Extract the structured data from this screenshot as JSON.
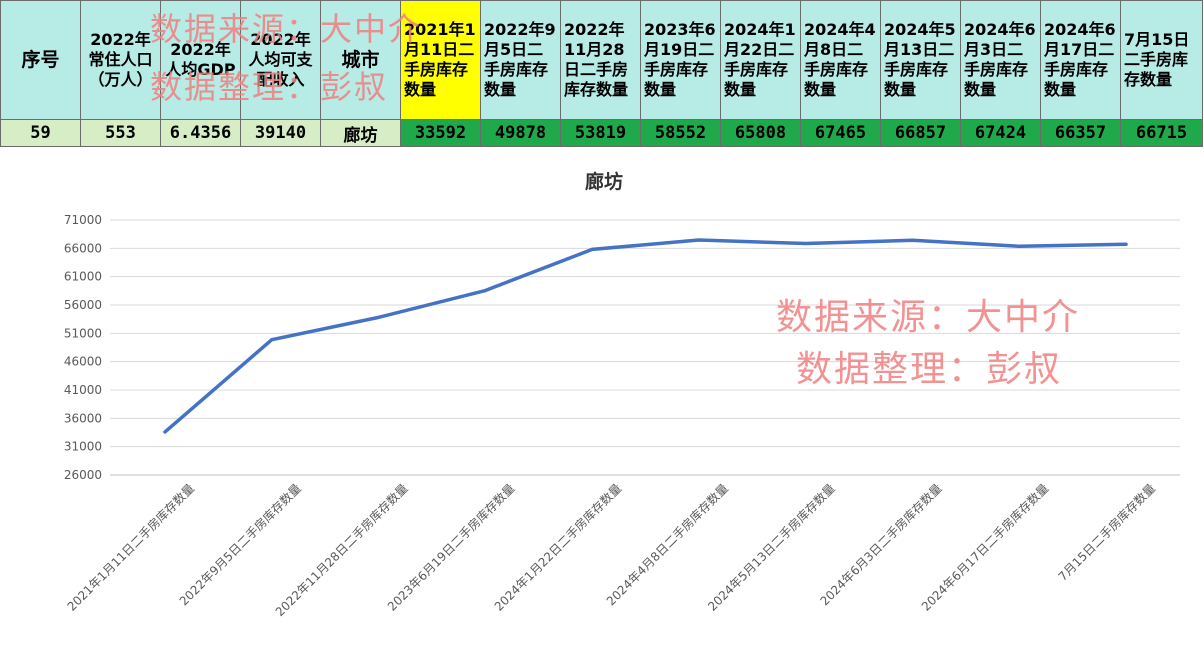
{
  "table": {
    "headers": [
      "序号",
      "2022年常住人口（万人）",
      "2022年人均GDP",
      "2022年人均可支配收入",
      "城市",
      "2021年1月11日二手房库存数量",
      "2022年9月5日二手房库存数量",
      "2022年11月28日二手房库存数量",
      "2023年6月19日二手房库存数量",
      "2024年1月22日二手房库存数量",
      "2024年4月8日二手房库存数量",
      "2024年5月13日二手房库存数量",
      "2024年6月3日二手房库存数量",
      "2024年6月17日二手房库存数量",
      "7月15日二手房库存数量"
    ],
    "row": [
      "59",
      "553",
      "6.4356",
      "39140",
      "廊坊",
      "33592",
      "49878",
      "53819",
      "58552",
      "65808",
      "67465",
      "66857",
      "67424",
      "66357",
      "66715"
    ]
  },
  "watermark": {
    "line1": "数据来源：大中介",
    "line2": "数据整理：彭叔"
  },
  "chart_data": {
    "type": "line",
    "title": "廊坊",
    "categories": [
      "2021年1月11日二手房库存数量",
      "2022年9月5日二手房库存数量",
      "2022年11月28日二手房库存数量",
      "2023年6月19日二手房库存数量",
      "2024年1月22日二手房库存数量",
      "2024年4月8日二手房库存数量",
      "2024年5月13日二手房库存数量",
      "2024年6月3日二手房库存数量",
      "2024年6月17日二手房库存数量",
      "7月15日二手房库存数量"
    ],
    "values": [
      33592,
      49878,
      53819,
      58552,
      65808,
      67465,
      66857,
      67424,
      66357,
      66715
    ],
    "ylim": [
      26000,
      71000
    ],
    "yticks": [
      26000,
      31000,
      36000,
      41000,
      46000,
      51000,
      56000,
      61000,
      66000,
      71000
    ],
    "grid": true,
    "line_color": "#4472c4",
    "xlabel": "",
    "ylabel": ""
  }
}
